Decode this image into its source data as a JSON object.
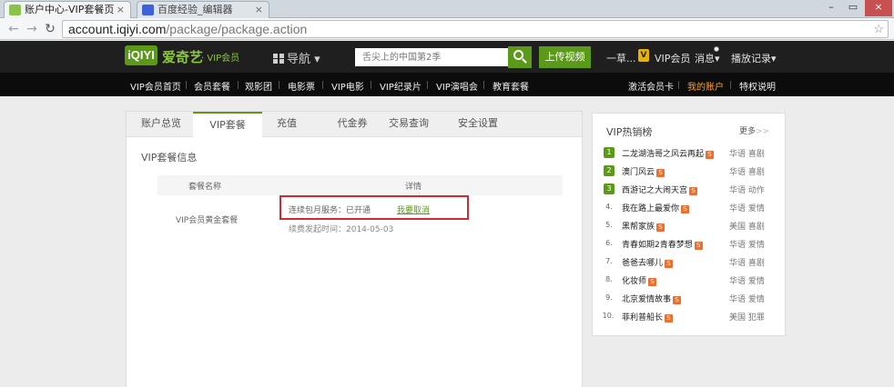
{
  "browser": {
    "tabs": [
      {
        "title": "账户中心-VIP套餐页",
        "favicon_color": "#8bc34a",
        "active": true
      },
      {
        "title": "百度经验_编辑器",
        "favicon_color": "#3b62d8",
        "active": false
      }
    ],
    "url_host": "account.iqiyi.com",
    "url_path": "/package/package.action"
  },
  "site_header": {
    "logo_mark": "iQIYI",
    "logo_name": "爱奇艺",
    "logo_sub": "· VIP会员",
    "guide_label": "导航",
    "search_placeholder": "舌尖上的中国第2季",
    "upload_label": "上传视频",
    "user_name": "一草...",
    "vip_badge": "V",
    "vip_label": "VIP会员",
    "messages_label": "消息",
    "history_label": "播放记录"
  },
  "menu": {
    "left": [
      "VIP会员首页",
      "会员套餐",
      "观影团",
      "电影票",
      "VIP电影",
      "VIP纪录片",
      "VIP演唱会",
      "教育套餐"
    ],
    "right": [
      "激活会员卡",
      "我的账户",
      "特权说明"
    ],
    "active_right": "我的账户"
  },
  "account": {
    "tabs": [
      "账户总览",
      "VIP套餐",
      "充值",
      "代金券",
      "交易查询",
      "安全设置"
    ],
    "active_tab": "VIP套餐",
    "section_title": "VIP套餐信息",
    "columns": [
      "套餐名称",
      "详情"
    ],
    "package_name": "VIP会员黄金套餐",
    "service_status": "连续包月服务：已开通",
    "cancel_link": "我要取消",
    "renew_text": "续费发起时间：2014-05-03"
  },
  "hot_list": {
    "title": "VIP热销榜",
    "more_label": "更多",
    "more_arrow": ">>",
    "tag": "S",
    "items": [
      {
        "rank": "1",
        "title": "二龙湖浩哥之风云再起",
        "genre": "华语 喜剧"
      },
      {
        "rank": "2",
        "title": "澳门风云",
        "genre": "华语 喜剧"
      },
      {
        "rank": "3",
        "title": "西游记之大闹天宫",
        "genre": "华语 动作"
      },
      {
        "rank": "4.",
        "title": "我在路上最爱你",
        "genre": "华语 爱情"
      },
      {
        "rank": "5.",
        "title": "黑帮家族",
        "genre": "美国 喜剧"
      },
      {
        "rank": "6.",
        "title": "青春如期2青春梦想",
        "genre": "华语 爱情"
      },
      {
        "rank": "7.",
        "title": "爸爸去哪儿",
        "genre": "华语 喜剧"
      },
      {
        "rank": "8.",
        "title": "化妆师",
        "genre": "华语 爱情"
      },
      {
        "rank": "9.",
        "title": "北京爱情故事",
        "genre": "华语 爱情"
      },
      {
        "rank": "10.",
        "title": "菲利普船长",
        "genre": "美国 犯罪"
      }
    ]
  },
  "colors": {
    "brand_green": "#5a9a18",
    "header_dark": "#1f1f1f",
    "menu_black": "#0c0c0c",
    "highlight_red": "#d9262f",
    "active_orange": "#f7a035",
    "tag_orange": "#e96f33"
  }
}
